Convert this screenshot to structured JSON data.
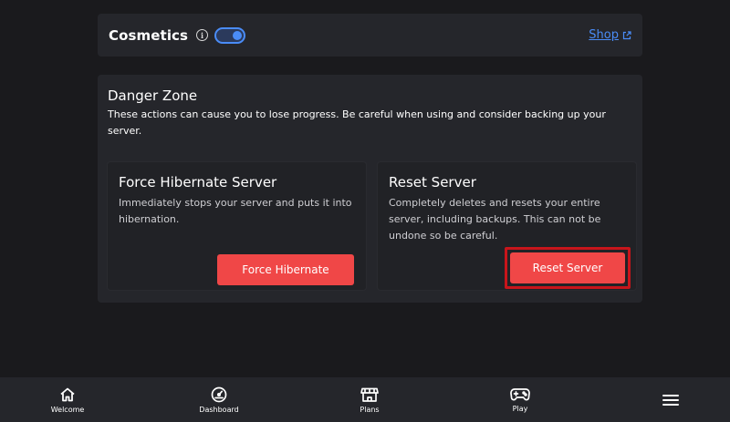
{
  "cosmetics": {
    "title": "Cosmetics",
    "toggle_on": true,
    "shop_label": "Shop"
  },
  "danger_zone": {
    "title": "Danger Zone",
    "description": "These actions can cause you to lose progress. Be careful when using and consider backing up your server."
  },
  "actions": {
    "hibernate": {
      "title": "Force Hibernate Server",
      "description": "Immediately stops your server and puts it into hibernation.",
      "button_label": "Force Hibernate"
    },
    "reset": {
      "title": "Reset Server",
      "description": "Completely deletes and resets your entire server, including backups. This can not be undone so be careful.",
      "button_label": "Reset Server"
    }
  },
  "nav": {
    "items": [
      {
        "label": "Welcome",
        "icon": "home-icon"
      },
      {
        "label": "Dashboard",
        "icon": "speedometer-icon"
      },
      {
        "label": "Plans",
        "icon": "store-icon"
      },
      {
        "label": "Play",
        "icon": "gamepad-icon"
      }
    ],
    "menu_icon": "hamburger-menu-icon"
  },
  "colors": {
    "background": "#1a1a1d",
    "card": "#25262b",
    "accent": "#4a8cf7",
    "danger": "#f04747",
    "highlight_border": "#c8151b"
  }
}
